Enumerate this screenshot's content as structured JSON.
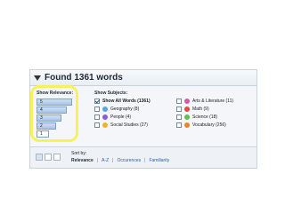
{
  "panel": {
    "title": "Found 1361 words",
    "relevance": {
      "label": "Show Relevance:",
      "levels": [
        "5",
        "4",
        "3",
        "2",
        "1"
      ]
    },
    "subjects": {
      "label": "Show Subjects:",
      "items": [
        {
          "name": "Show All Words (1361)",
          "checked": true,
          "icon": "check-icon"
        },
        {
          "name": "Arts & Literature (11)",
          "checked": false,
          "icon": "arts-icon"
        },
        {
          "name": "Geography (8)",
          "checked": false,
          "icon": "globe-icon"
        },
        {
          "name": "Math (9)",
          "checked": false,
          "icon": "math-icon"
        },
        {
          "name": "People (4)",
          "checked": false,
          "icon": "people-icon"
        },
        {
          "name": "Science (18)",
          "checked": false,
          "icon": "science-icon"
        },
        {
          "name": "Social Studies (27)",
          "checked": false,
          "icon": "social-icon"
        },
        {
          "name": "Vocabulary (256)",
          "checked": false,
          "icon": "vocabulary-icon"
        }
      ]
    },
    "sort": {
      "label": "Sort by:",
      "options": [
        "Relevance",
        "A-Z",
        "Occurences",
        "Familiarity"
      ],
      "active": "Relevance"
    }
  }
}
